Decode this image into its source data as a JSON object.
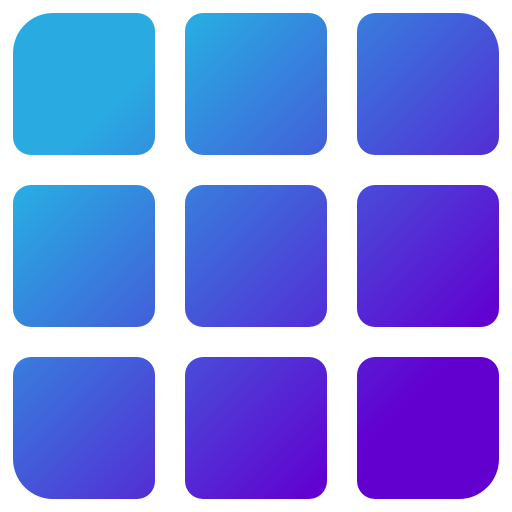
{
  "icon": {
    "name": "app-grid-icon",
    "gradient": {
      "start_color": "#29abe2",
      "end_color": "#6200d0"
    },
    "tiles": [
      {
        "name": "tile-top-left"
      },
      {
        "name": "tile-top-center"
      },
      {
        "name": "tile-top-right"
      },
      {
        "name": "tile-middle-left"
      },
      {
        "name": "tile-middle-center"
      },
      {
        "name": "tile-middle-right"
      },
      {
        "name": "tile-bottom-left"
      },
      {
        "name": "tile-bottom-center"
      },
      {
        "name": "tile-bottom-right"
      }
    ]
  }
}
